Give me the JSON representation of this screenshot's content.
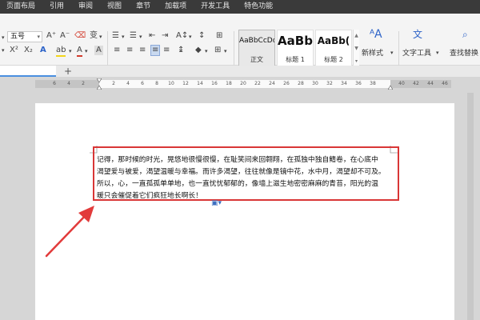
{
  "menu": {
    "items": [
      "页面布局",
      "引用",
      "审阅",
      "视图",
      "章节",
      "加载项",
      "开发工具",
      "特色功能"
    ]
  },
  "ribbon": {
    "font_size_value": "五号",
    "grow_font": "A⁺",
    "shrink_font": "A⁻",
    "superscript": "X²",
    "subscript": "X₂",
    "font_color_letter": "A",
    "highlight_letter": "ab",
    "char_border_letter": "A",
    "text_effect_letter": "A",
    "styles": [
      {
        "sample": "AaBbCcDd",
        "name": "正文"
      },
      {
        "sample": "AaBb",
        "name": "标题 1"
      },
      {
        "sample": "AaBb(",
        "name": "标题 2"
      }
    ],
    "new_style": "新样式",
    "text_tools": "文字工具",
    "find_replace": "查找替换"
  },
  "ruler": {
    "ticks": [
      "6",
      "4",
      "2",
      "2",
      "4",
      "6",
      "8",
      "10",
      "12",
      "14",
      "16",
      "18",
      "20",
      "22",
      "24",
      "26",
      "28",
      "30",
      "32",
      "34",
      "36",
      "38",
      "40",
      "42",
      "44",
      "46"
    ]
  },
  "document": {
    "lines": [
      "记得，那时候的时光，晃悠地很慢很慢，在耻笑间来回翱翔，在孤独中独自鳍卷，在心底中",
      "渴望爱与被爱，渴望温暖与幸福。而许多渴望，往往就像是镜中花，水中月，渴望却不可及。",
      "所以，心，一直孤孤单单地，也一直忧忧郁郁的，像墙上滋生地密密麻麻的青苔，阳光的温",
      "暖只会催促着它们疯狂地长啊长！"
    ]
  },
  "colors": {
    "menubar": "#3a3a3a",
    "highlight_box": "#d93636",
    "arrow": "#e23b3b",
    "accent": "#4a8fe0"
  }
}
